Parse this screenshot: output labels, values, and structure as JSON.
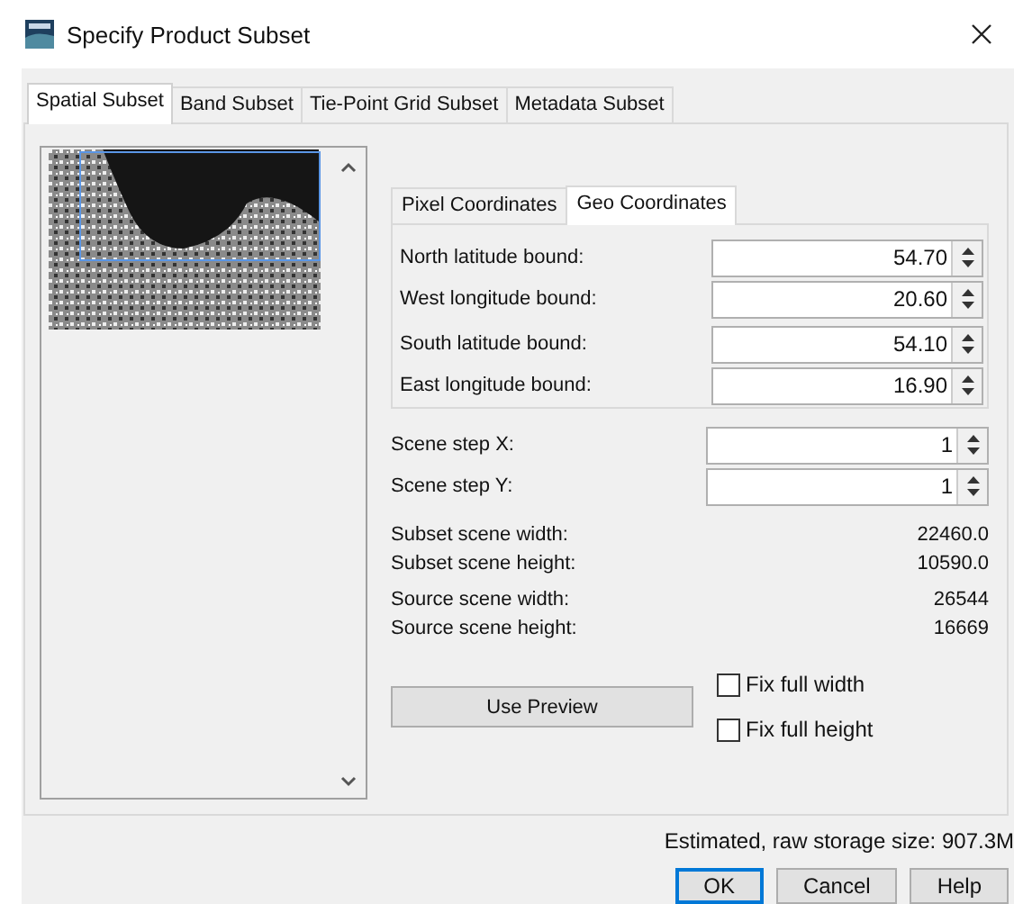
{
  "window": {
    "title": "Specify Product Subset"
  },
  "tabs": [
    {
      "label": "Spatial Subset",
      "selected": true
    },
    {
      "label": "Band Subset",
      "selected": false
    },
    {
      "label": "Tie-Point Grid Subset",
      "selected": false
    },
    {
      "label": "Metadata Subset",
      "selected": false
    }
  ],
  "coordinate_tabs": [
    {
      "label": "Pixel Coordinates",
      "selected": false
    },
    {
      "label": "Geo Coordinates",
      "selected": true
    }
  ],
  "geo_bounds": [
    {
      "rows": [
        {
          "label": "North latitude bound:",
          "value": "54.70"
        },
        {
          "label": "West longitude bound:",
          "value": "20.60"
        }
      ]
    },
    {
      "rows": [
        {
          "label": "South latitude bound:",
          "value": "54.10"
        },
        {
          "label": "East longitude bound:",
          "value": "16.90"
        }
      ]
    }
  ],
  "scene_steps": [
    {
      "label": "Scene step X:",
      "value": "1"
    },
    {
      "label": "Scene step Y:",
      "value": "1"
    }
  ],
  "info_groups": [
    {
      "rows": [
        {
          "label": "Subset scene width:",
          "value": "22460.0"
        },
        {
          "label": "Subset scene height:",
          "value": "10590.0"
        }
      ]
    },
    {
      "rows": [
        {
          "label": "Source scene width:",
          "value": "26544"
        },
        {
          "label": "Source scene height:",
          "value": "16669"
        }
      ]
    }
  ],
  "use_preview_button": "Use Preview",
  "fix_options": [
    {
      "label": "Fix full width",
      "checked": false
    },
    {
      "label": "Fix full height",
      "checked": false
    }
  ],
  "storage_estimate": "Estimated, raw storage size: 907.3M",
  "buttons": [
    {
      "label": "OK",
      "default": true
    },
    {
      "label": "Cancel",
      "default": false
    },
    {
      "label": "Help",
      "default": false
    }
  ]
}
